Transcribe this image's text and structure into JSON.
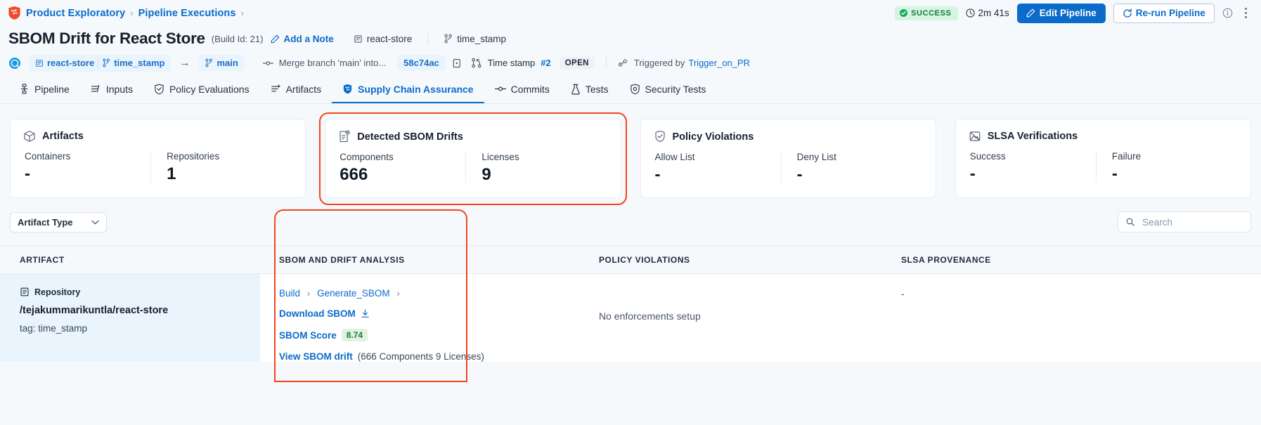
{
  "breadcrumb": {
    "logo_icon": "harness-shield-icon",
    "items": [
      {
        "label": "Product Exploratory"
      },
      {
        "label": "Pipeline Executions"
      }
    ],
    "separator": "›"
  },
  "topbar": {
    "status_badge": "SUCCESS",
    "status_color": "#137a3f",
    "status_bg": "#d6f5e0",
    "duration": "2m 41s",
    "clock_icon": "clock-icon",
    "edit_button": "Edit Pipeline",
    "edit_icon": "pencil-icon",
    "rerun_button": "Re-run Pipeline",
    "rerun_icon": "refresh-icon",
    "info_icon": "info-circle-icon",
    "more_icon": "kebab-menu-icon"
  },
  "header": {
    "title": "SBOM Drift for React Store",
    "build_id": "(Build Id: 21)",
    "add_note": "Add a Note",
    "add_note_icon": "pencil-icon",
    "repo_chip": "react-store",
    "repo_chip_icon": "repository-icon",
    "branch_chip": "time_stamp",
    "branch_chip_icon": "branch-icon"
  },
  "meta": {
    "execution_icon": "execution-status-icon",
    "repo": "react-store",
    "repo_icon": "repository-icon",
    "source_branch": "time_stamp",
    "source_branch_icon": "branch-icon",
    "arrow": "→",
    "target_branch": "main",
    "target_branch_icon": "branch-icon",
    "commit_message": "Merge branch 'main' into...",
    "commit_icon": "commit-node-icon",
    "commit_sha": "58c74ac",
    "copy_icon": "copy-icon",
    "pr_icon": "pull-request-icon",
    "pr_title": "Time stamp",
    "pr_number": "#2",
    "pr_state": "OPEN",
    "trigger_icon": "trigger-icon",
    "trigger_prefix": "Triggered by",
    "trigger_name": "Trigger_on_PR"
  },
  "tabs": [
    {
      "label": "Pipeline",
      "icon": "pipeline-icon",
      "active": false
    },
    {
      "label": "Inputs",
      "icon": "inputs-icon",
      "active": false
    },
    {
      "label": "Policy Evaluations",
      "icon": "policy-shield-icon",
      "active": false
    },
    {
      "label": "Artifacts",
      "icon": "artifacts-icon",
      "active": false
    },
    {
      "label": "Supply Chain Assurance",
      "icon": "supply-chain-shield-icon",
      "active": true
    },
    {
      "label": "Commits",
      "icon": "commit-node-icon",
      "active": false
    },
    {
      "label": "Tests",
      "icon": "flask-icon",
      "active": false
    },
    {
      "label": "Security Tests",
      "icon": "security-shield-icon",
      "active": false
    }
  ],
  "cards": [
    {
      "title": "Artifacts",
      "icon": "cube-icon",
      "highlighted": false,
      "stats": [
        {
          "label": "Containers",
          "value": "-"
        },
        {
          "label": "Repositories",
          "value": "1"
        }
      ]
    },
    {
      "title": "Detected SBOM Drifts",
      "icon": "document-drift-icon",
      "highlighted": true,
      "stats": [
        {
          "label": "Components",
          "value": "666"
        },
        {
          "label": "Licenses",
          "value": "9"
        }
      ]
    },
    {
      "title": "Policy Violations",
      "icon": "shield-check-icon",
      "highlighted": false,
      "stats": [
        {
          "label": "Allow List",
          "value": "-"
        },
        {
          "label": "Deny List",
          "value": "-"
        }
      ]
    },
    {
      "title": "SLSA Verifications",
      "icon": "slsa-icon",
      "highlighted": false,
      "stats": [
        {
          "label": "Success",
          "value": "-"
        },
        {
          "label": "Failure",
          "value": "-"
        }
      ]
    }
  ],
  "filters": {
    "artifact_type_label": "Artifact Type",
    "chevron_icon": "chevron-down-icon",
    "search_placeholder": "Search",
    "search_value": "",
    "search_icon": "search-icon"
  },
  "table": {
    "columns": [
      {
        "key": "artifact",
        "label": "ARTIFACT"
      },
      {
        "key": "sbom",
        "label": "SBOM AND DRIFT ANALYSIS",
        "highlighted": true
      },
      {
        "key": "policy",
        "label": "POLICY VIOLATIONS"
      },
      {
        "key": "slsa",
        "label": "SLSA PROVENANCE"
      }
    ],
    "rows": [
      {
        "artifact": {
          "type_label": "Repository",
          "type_icon": "repository-icon",
          "path": "/tejakummarikuntla/react-store",
          "tag": "tag: time_stamp"
        },
        "sbom": {
          "breadcrumb": [
            "Build",
            "Generate_SBOM"
          ],
          "breadcrumb_sep": "›",
          "download_label": "Download SBOM",
          "download_icon": "download-icon",
          "score_label": "SBOM Score",
          "score_value": "8.74",
          "drift_label": "View SBOM drift",
          "drift_detail": "(666 Components 9 Licenses)"
        },
        "policy": {
          "text": "No enforcements setup"
        },
        "slsa": {
          "text": "-"
        }
      }
    ]
  },
  "colors": {
    "accent": "#0b6bcb",
    "highlight_ring": "#f4441e",
    "page_bg": "#f6f9fc",
    "success": "#137a3f"
  }
}
